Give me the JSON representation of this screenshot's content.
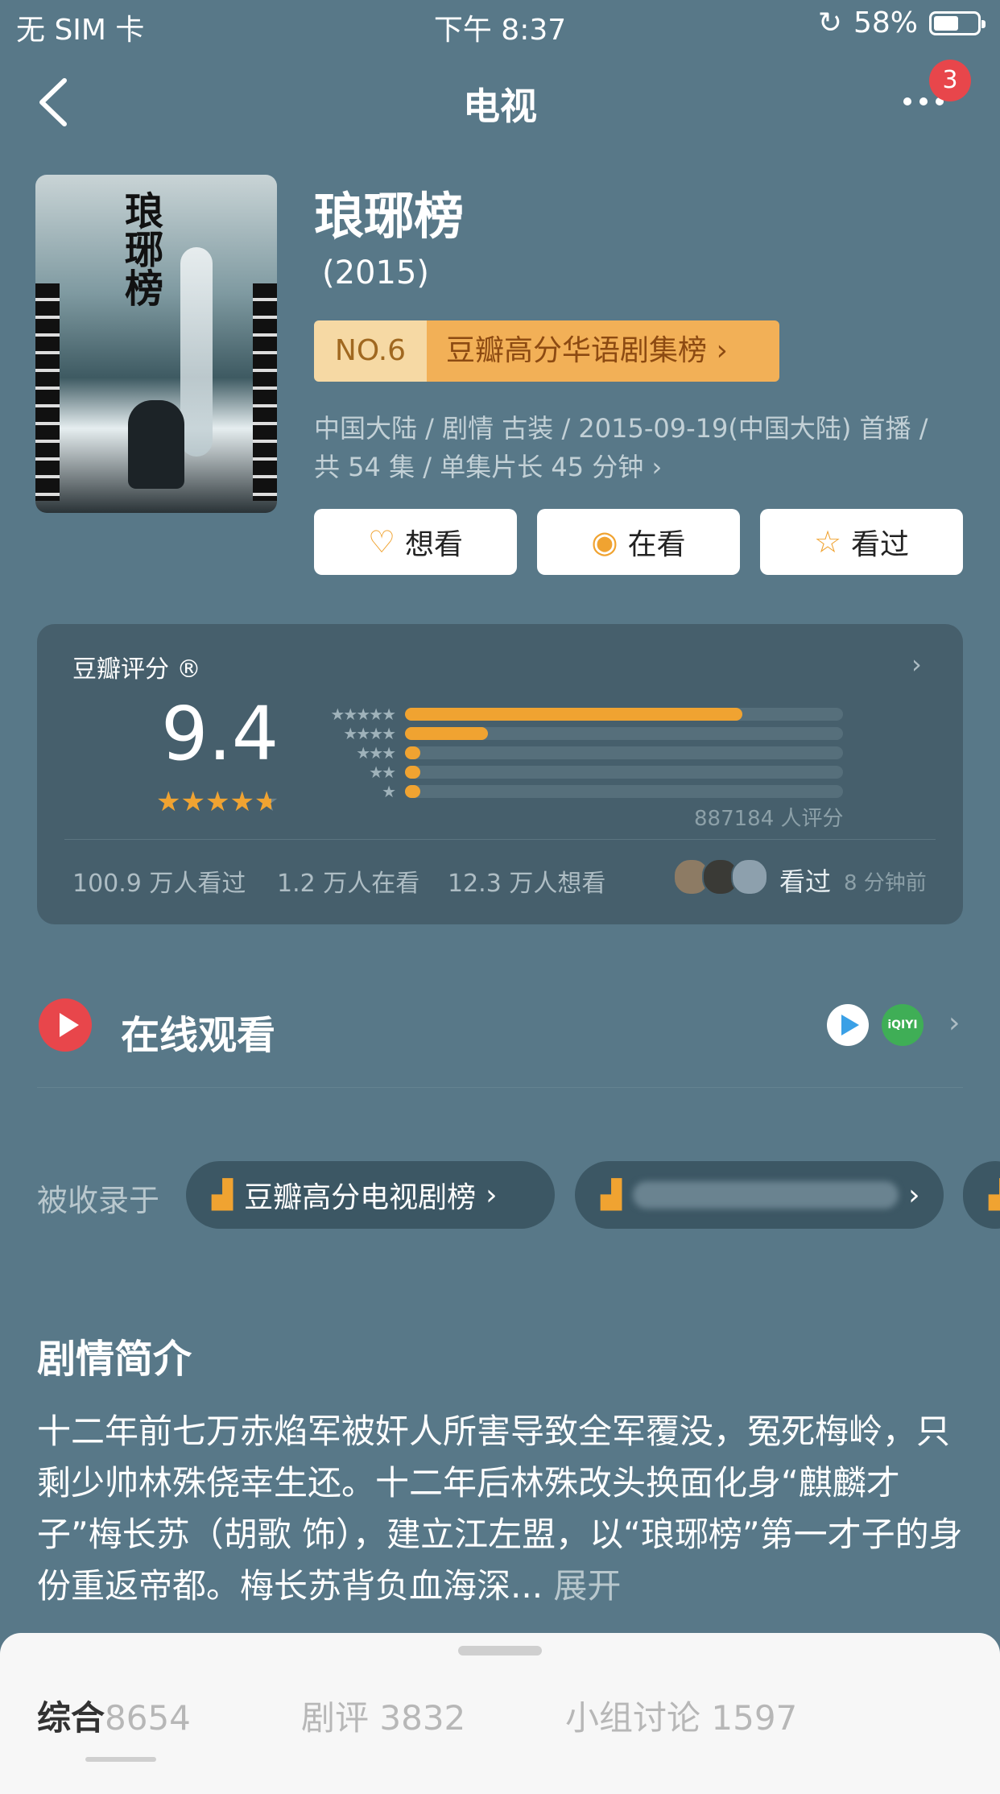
{
  "status_bar": {
    "carrier": "无 SIM 卡",
    "time": "下午 8:37",
    "battery": "58%",
    "battery_level": 0.58
  },
  "nav": {
    "title": "电视",
    "badge_count": "3"
  },
  "movie": {
    "title": "琅琊榜",
    "year": "(2015)",
    "rank_no": "NO.6",
    "rank_list": "豆瓣高分华语剧集榜",
    "meta_line1": "中国大陆 / 剧情 古装 / 2015-09-19(中国大陆) 首播 /",
    "meta_line2": "共 54 集 / 单集片长 45 分钟",
    "poster_title": "琅琊榜"
  },
  "actions": [
    {
      "label": "想看",
      "icon": "heart-plus-icon"
    },
    {
      "label": "在看",
      "icon": "target-icon"
    },
    {
      "label": "看过",
      "icon": "star-outline-icon"
    }
  ],
  "rating": {
    "title": "豆瓣评分 ®",
    "score": "9.4",
    "stars_text": "★★★★★",
    "star_value": 4.7,
    "distribution": [
      {
        "stars": "★★★★★",
        "fraction": 0.77
      },
      {
        "stars": "★★★★",
        "fraction": 0.19
      },
      {
        "stars": "★★★",
        "fraction": 0.035
      },
      {
        "stars": "★★",
        "fraction": 0.035
      },
      {
        "stars": "★",
        "fraction": 0.035
      }
    ],
    "count": "887184 人评分",
    "watched": "100.9 万人看过",
    "watching": "1.2 万人在看",
    "want": "12.3 万人想看",
    "friend_action": "看过",
    "friend_time": "8 分钟前"
  },
  "online": {
    "label": "在线观看",
    "providers": [
      "tencent-video-icon",
      "iqiyi-icon"
    ],
    "iqiyi_text": "iQIYI"
  },
  "included": {
    "label": "被收录于",
    "lists": [
      {
        "name": "豆瓣高分电视剧榜"
      }
    ]
  },
  "synopsis": {
    "title": "剧情简介",
    "text": "十二年前七万赤焰军被奸人所害导致全军覆没，冤死梅岭，只剩少帅林殊侥幸生还。十二年后林殊改头换面化身“麒麟才子”梅长苏（胡歌 饰），建立江左盟，以“琅琊榜”第一才子的身份重返帝都。梅长苏背负血海深...",
    "expand": "展开"
  },
  "tabs": [
    {
      "label": "综合",
      "count": "8654"
    },
    {
      "label": "剧评",
      "count": "3832"
    },
    {
      "label": "小组讨论",
      "count": "1597"
    }
  ],
  "colors": {
    "background": "#587888",
    "accent": "#f0a331",
    "badge": "#e8464b",
    "card": "#465f6c"
  }
}
